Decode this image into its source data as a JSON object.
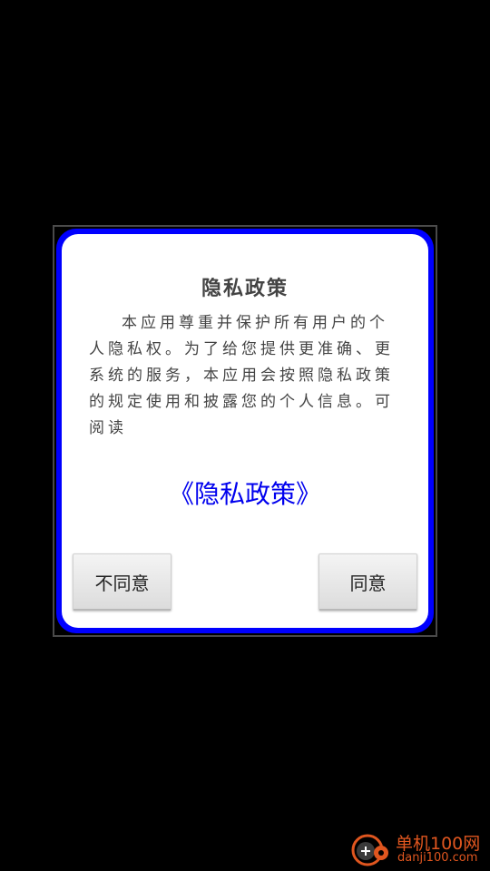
{
  "dialog": {
    "title": "隐私政策",
    "body": "本应用尊重并保护所有用户的个人隐私权。为了给您提供更准确、更系统的服务，本应用会按照隐私政策的规定使用和披露您的个人信息。可阅读",
    "policy_link": "《隐私政策》",
    "disagree_label": "不同意",
    "agree_label": "同意"
  },
  "watermark": {
    "name": "单机100网",
    "url": "danji100.com"
  },
  "colors": {
    "background": "#000000",
    "dialog_border": "#0000ff",
    "link": "#0000ee",
    "watermark": "#e0561f"
  }
}
